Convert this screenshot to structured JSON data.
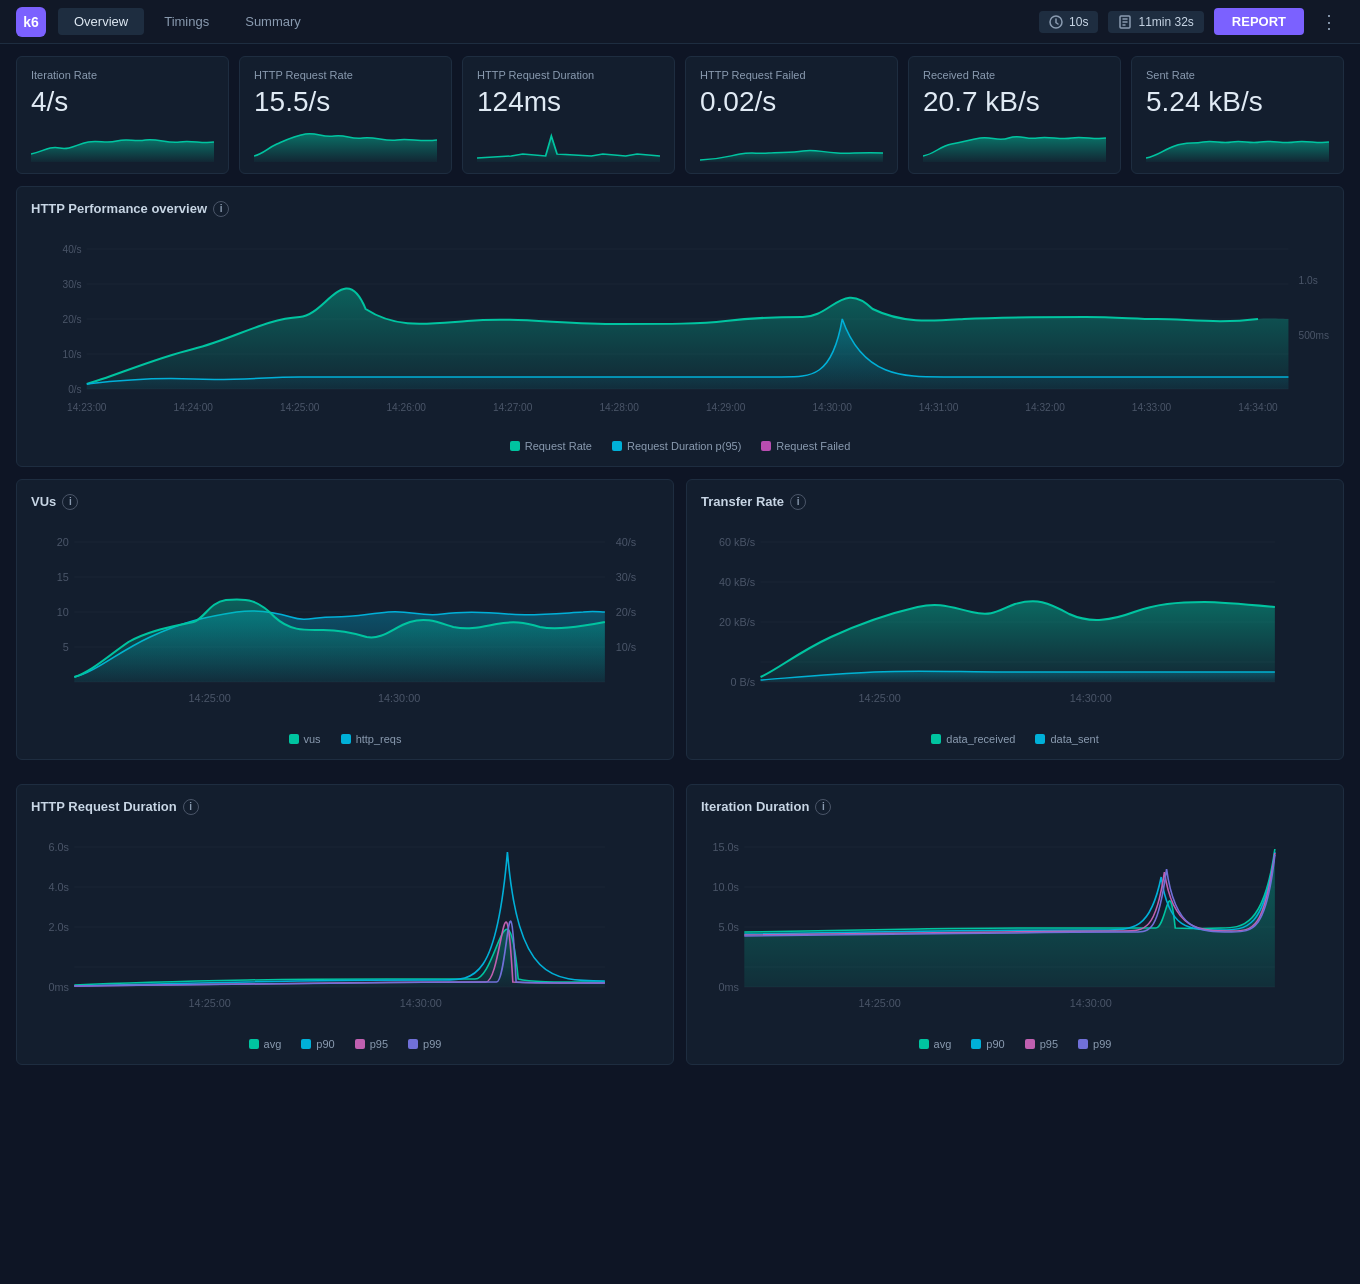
{
  "header": {
    "logo": "k6",
    "tabs": [
      {
        "label": "Overview",
        "active": true
      },
      {
        "label": "Timings",
        "active": false
      },
      {
        "label": "Summary",
        "active": false
      }
    ],
    "time_interval": "10s",
    "duration": "11min 32s",
    "report_label": "REPORT"
  },
  "metrics": [
    {
      "label": "Iteration Rate",
      "value": "4/s",
      "color": "#00c4a0"
    },
    {
      "label": "HTTP Request Rate",
      "value": "15.5/s",
      "color": "#00c4a0"
    },
    {
      "label": "HTTP Request Duration",
      "value": "124ms",
      "color": "#00c4a0"
    },
    {
      "label": "HTTP Request Failed",
      "value": "0.02/s",
      "color": "#00c4a0"
    },
    {
      "label": "Received Rate",
      "value": "20.7 kB/s",
      "color": "#00c4a0"
    },
    {
      "label": "Sent Rate",
      "value": "5.24 kB/s",
      "color": "#00c4a0"
    }
  ],
  "http_perf": {
    "title": "HTTP Performance overview",
    "y_left_labels": [
      "40/s",
      "30/s",
      "20/s",
      "10/s",
      "0/s"
    ],
    "y_right_labels": [
      "1.0s",
      "500ms"
    ],
    "x_labels": [
      "14:23:00",
      "14:24:00",
      "14:25:00",
      "14:26:00",
      "14:27:00",
      "14:28:00",
      "14:29:00",
      "14:30:00",
      "14:31:00",
      "14:32:00",
      "14:33:00",
      "14:34:00"
    ],
    "legend": [
      {
        "label": "Request Rate",
        "color": "#00c4a0"
      },
      {
        "label": "Request Duration p(95)",
        "color": "#00b0d8"
      },
      {
        "label": "Request Failed",
        "color": "#b84db0"
      }
    ]
  },
  "vus": {
    "title": "VUs",
    "y_left_labels": [
      "20",
      "15",
      "10",
      "5"
    ],
    "y_right_labels": [
      "40/s",
      "30/s",
      "20/s",
      "10/s"
    ],
    "x_labels": [
      "14:25:00",
      "14:30:00"
    ],
    "legend": [
      {
        "label": "vus",
        "color": "#00c4a0"
      },
      {
        "label": "http_reqs",
        "color": "#00b0d8"
      }
    ]
  },
  "transfer": {
    "title": "Transfer Rate",
    "y_labels": [
      "60 kB/s",
      "40 kB/s",
      "20 kB/s",
      "0 B/s"
    ],
    "x_labels": [
      "14:25:00",
      "14:30:00"
    ],
    "legend": [
      {
        "label": "data_received",
        "color": "#00c4a0"
      },
      {
        "label": "data_sent",
        "color": "#00b0d8"
      }
    ]
  },
  "http_duration": {
    "title": "HTTP Request Duration",
    "y_labels": [
      "6.0s",
      "4.0s",
      "2.0s",
      "0ms"
    ],
    "x_labels": [
      "14:25:00",
      "14:30:00"
    ],
    "legend": [
      {
        "label": "avg",
        "color": "#00c4a0"
      },
      {
        "label": "p90",
        "color": "#00b0d8"
      },
      {
        "label": "p95",
        "color": "#c060b0"
      },
      {
        "label": "p99",
        "color": "#7070d8"
      }
    ]
  },
  "iter_duration": {
    "title": "Iteration Duration",
    "y_labels": [
      "15.0s",
      "10.0s",
      "5.0s",
      "0ms"
    ],
    "x_labels": [
      "14:25:00",
      "14:30:00"
    ],
    "legend": [
      {
        "label": "avg",
        "color": "#00c4a0"
      },
      {
        "label": "p90",
        "color": "#00b0d8"
      },
      {
        "label": "p95",
        "color": "#c060b0"
      },
      {
        "label": "p99",
        "color": "#7070d8"
      }
    ]
  }
}
